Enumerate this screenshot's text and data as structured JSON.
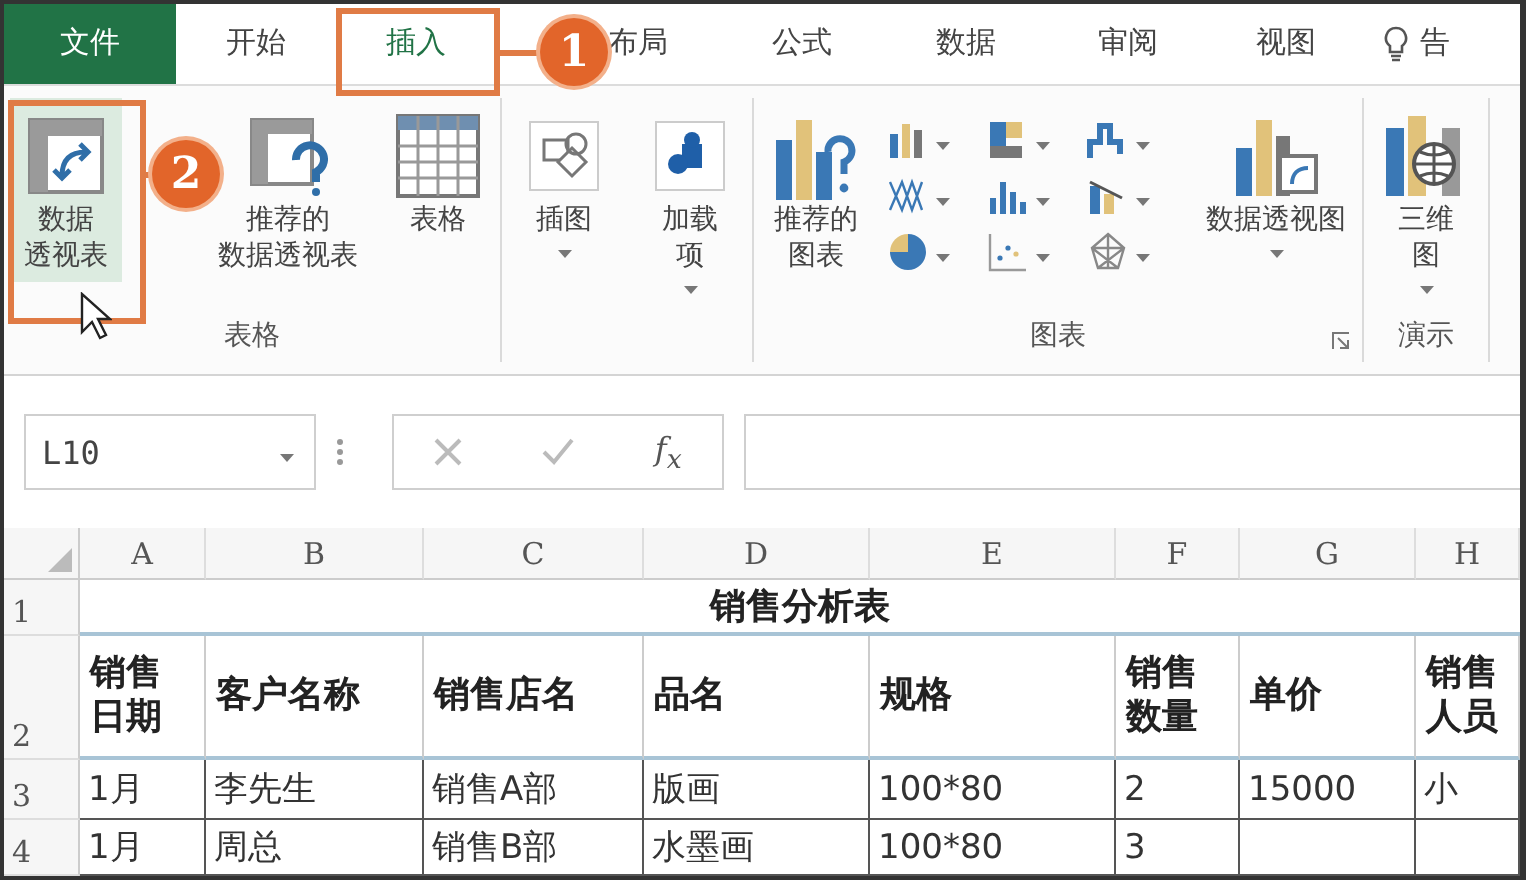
{
  "tabs": [
    {
      "label": "文件",
      "kind": "file",
      "selected": false
    },
    {
      "label": "开始",
      "kind": "tab",
      "selected": false
    },
    {
      "label": "插入",
      "kind": "tab",
      "selected": true
    },
    {
      "label": "布局",
      "kind": "tab",
      "selected": false
    },
    {
      "label": "公式",
      "kind": "tab",
      "selected": false
    },
    {
      "label": "数据",
      "kind": "tab",
      "selected": false
    },
    {
      "label": "审阅",
      "kind": "tab",
      "selected": false
    },
    {
      "label": "视图",
      "kind": "tab",
      "selected": false
    },
    {
      "label": "告",
      "kind": "tell",
      "selected": false
    }
  ],
  "callouts": [
    {
      "label": "1"
    },
    {
      "label": "2"
    }
  ],
  "ribbon": {
    "groups": [
      {
        "label": "表格",
        "commands": [
          {
            "kind": "large",
            "lines": [
              "数据",
              "透视表"
            ],
            "selected": true,
            "dropdown": false
          },
          {
            "kind": "large",
            "lines": [
              "推荐的",
              "数据透视表"
            ],
            "selected": false,
            "dropdown": false
          },
          {
            "kind": "large",
            "lines": [
              "表格"
            ],
            "selected": false,
            "dropdown": false
          }
        ]
      },
      {
        "commands": [
          {
            "kind": "large",
            "lines": [
              "插图"
            ],
            "selected": false,
            "dropdown": true
          },
          {
            "kind": "large",
            "lines": [
              "加载",
              "项"
            ],
            "selected": false,
            "dropdown": true
          }
        ]
      },
      {
        "label": "图表",
        "launcher": true,
        "commands": [
          {
            "kind": "large",
            "lines": [
              "推荐的",
              "图表"
            ],
            "selected": false,
            "dropdown": false
          },
          {
            "kind": "gallery"
          },
          {
            "kind": "large",
            "lines": [
              "数据透视图"
            ],
            "selected": false,
            "dropdown": true
          }
        ]
      },
      {
        "label": "演示",
        "commands": [
          {
            "kind": "large",
            "lines": [
              "三维",
              "图"
            ],
            "selected": false,
            "dropdown": true
          }
        ]
      }
    ]
  },
  "formula_bar": {
    "name_box": "L10",
    "function_label": "f$_{x}$"
  },
  "sheet": {
    "columns": [
      "A",
      "B",
      "C",
      "D",
      "E",
      "F",
      "G",
      "H"
    ],
    "title_row": {
      "number": "1",
      "title": "销售分析表"
    },
    "header_row": {
      "number": "2",
      "cells": [
        "销售日期",
        "客户名称",
        "销售店名",
        "品名",
        "规格",
        "销售数量",
        "单价",
        "销售人员"
      ]
    },
    "rows": [
      {
        "number": "3",
        "cells": [
          "1月",
          "李先生",
          "销售A部",
          "版画",
          "100*80",
          "2",
          "15000",
          "小"
        ]
      },
      {
        "number": "4",
        "cells": [
          "1月",
          "周总",
          "销售B部",
          "水墨画",
          "100*80",
          "3",
          "",
          ""
        ]
      }
    ]
  }
}
